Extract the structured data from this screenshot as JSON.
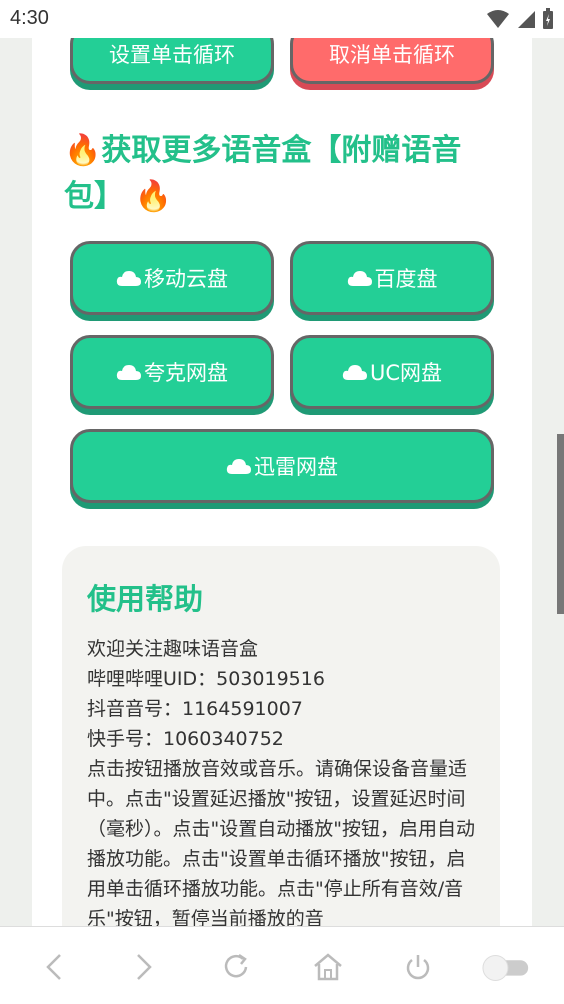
{
  "status": {
    "time": "4:30"
  },
  "top_buttons": {
    "set_loop": "设置单击循环",
    "cancel_loop": "取消单击循环"
  },
  "section": {
    "fire_emoji": "🔥",
    "title": "获取更多语音盒【附赠语音包】"
  },
  "downloads": [
    {
      "label": "移动云盘"
    },
    {
      "label": "百度盘"
    },
    {
      "label": "夸克网盘"
    },
    {
      "label": "UC网盘"
    },
    {
      "label": "迅雷网盘"
    }
  ],
  "help": {
    "title": "使用帮助",
    "lines": [
      "欢迎关注趣味语音盒",
      "哔哩哔哩UID：503019516",
      "抖音音号：1164591007",
      "快手号：1060340752"
    ],
    "body": "点击按钮播放音效或音乐。请确保设备音量适中。点击\"设置延迟播放\"按钮，设置延迟时间（毫秒）。点击\"设置自动播放\"按钮，启用自动播放功能。点击\"设置单击循环播放\"按钮，启用单击循环播放功能。点击\"停止所有音效/音乐\"按钮，暂停当前播放的音"
  },
  "icons": {
    "cloud": "cloud-icon",
    "nav": [
      "back-icon",
      "forward-icon",
      "reload-icon",
      "home-icon",
      "power-icon",
      "toggle-icon"
    ]
  },
  "colors": {
    "accent": "#23cf96",
    "danger": "#ff6b6b",
    "title_green": "#23c08a"
  }
}
